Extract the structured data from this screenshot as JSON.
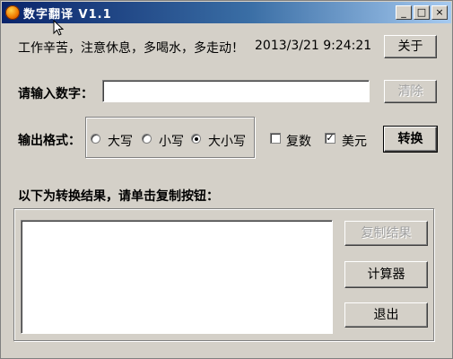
{
  "window": {
    "title": "数字翻译 V1.1",
    "controls": {
      "minimize": "_",
      "maximize": "□",
      "close": "×"
    }
  },
  "header": {
    "reminder": "工作辛苦，注意休息，多喝水，多走动！",
    "datetime": "2013/3/21 9:24:21",
    "about_label": "关于"
  },
  "input": {
    "label": "请输入数字：",
    "value": "",
    "clear_label": "清除"
  },
  "format": {
    "label": "输出格式：",
    "options": [
      {
        "label": "大写",
        "selected": false
      },
      {
        "label": "小写",
        "selected": false
      },
      {
        "label": "大小写",
        "selected": true
      }
    ],
    "plural": {
      "label": "复数",
      "checked": false
    },
    "dollar": {
      "label": "美元",
      "checked": true
    },
    "convert_label": "转换"
  },
  "result": {
    "heading": "以下为转换结果，请单击复制按钮：",
    "text": "",
    "copy_label": "复制结果",
    "calculator_label": "计算器",
    "exit_label": "退出"
  },
  "icons": {
    "app": "app-logo-icon",
    "cursor": "mouse-cursor-icon"
  },
  "colors": {
    "titlebar_start": "#0a246a",
    "titlebar_end": "#a6caf0",
    "face": "#d4d0c8",
    "disabled_text": "#a0a0a0"
  }
}
